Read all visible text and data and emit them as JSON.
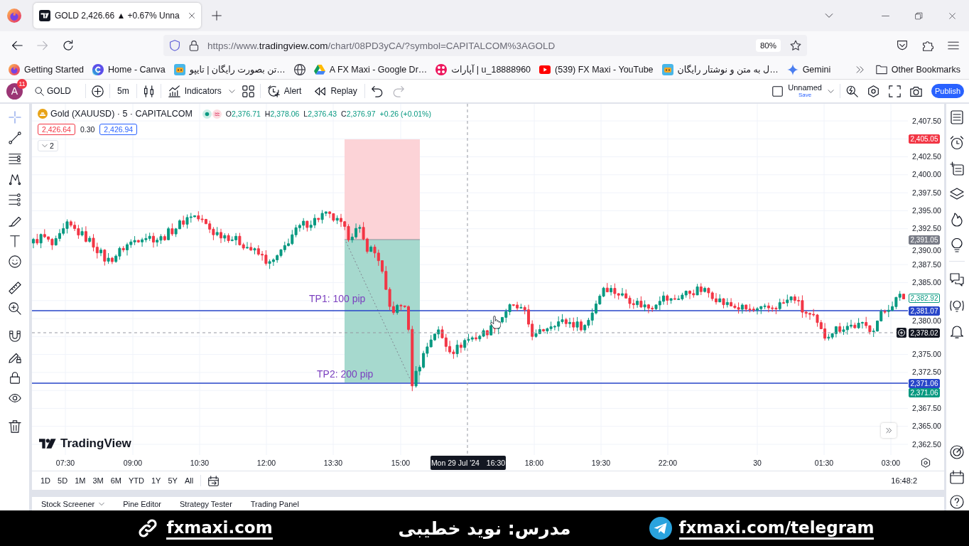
{
  "browser": {
    "tabs": [
      {
        "title": "GOLD 2,426.66 ▲ +0.67% Unna",
        "selected": true
      }
    ],
    "nav_buttons": [
      {
        "kind": "back",
        "disabled": false
      },
      {
        "kind": "forward",
        "disabled": true
      },
      {
        "kind": "reload",
        "disabled": false
      }
    ],
    "url": {
      "scheme": "https://www.",
      "domain": "tradingview.com",
      "path": "/chart/08PD3yCA/?symbol=CAPITALCOM%3AGOLD"
    },
    "zoom": "80%",
    "bookmarks": [
      {
        "kind": "flame-circle",
        "label": "Getting Started"
      },
      {
        "kind": "c-circle",
        "label": "Home - Canva"
      },
      {
        "kind": "tile",
        "label": "تن بصورت رایگان | تایپو…"
      },
      {
        "kind": "globe"
      },
      {
        "kind": "triangle",
        "label": "A FX Maxi - Google Dr…"
      },
      {
        "kind": "flower",
        "label": "آپارات | u_18888960"
      },
      {
        "kind": "play",
        "label": "(539) FX Maxi - YouTube"
      },
      {
        "kind": "tile",
        "label": "ل به متن و نوشتار رایگان…"
      },
      {
        "kind": "sparkle",
        "label": "Gemini"
      }
    ],
    "other_bookmarks": "Other Bookmarks"
  },
  "chart_toolbar": {
    "avatar": {
      "initial": "A",
      "badge": "11"
    },
    "symbol": "GOLD",
    "interval": "5m",
    "indicators": "Indicators",
    "alert": "Alert",
    "replay": "Replay",
    "history": [
      {
        "kind": "undo",
        "disabled": false
      },
      {
        "kind": "redo",
        "disabled": true
      }
    ],
    "layout": {
      "name": "Unnamed",
      "action": "Save"
    },
    "publish": "Publish"
  },
  "legend": {
    "title": "Gold (XAUUSD) · 5 · CAPITALCOM",
    "ohlc": [
      {
        "label": "O",
        "value": "2,376.71"
      },
      {
        "label": "H",
        "value": "2,378.06"
      },
      {
        "label": "L",
        "value": "2,376.43"
      },
      {
        "label": "C",
        "value": "2,376.97"
      }
    ],
    "change": "+0.26 (+0.01%)",
    "sell": "2,426.64",
    "spread": "0.30",
    "buy": "2,426.94",
    "hidden_count": "2"
  },
  "chart": {
    "labels": [
      "TP1: 100 pip",
      "TP2: 200 pip"
    ],
    "logo": "TradingView"
  },
  "price_axis": {
    "labels": [
      "2,407.50",
      "2,402.50",
      "2,400.00",
      "2,397.50",
      "2,395.00",
      "2,392.50",
      "2,390.00",
      "2,387.50",
      "2,385.00",
      "2,380.00",
      "2,375.00",
      "2,372.50",
      "2,367.50",
      "2,365.00",
      "2,362.50"
    ],
    "tags": [
      {
        "text": "2,405.05",
        "color": "#f23645",
        "kind": "filled"
      },
      {
        "text": "2,391.05",
        "color": "#787b86",
        "kind": "filled"
      },
      {
        "text": "2,382.92",
        "color": "#089981",
        "kind": "outline"
      },
      {
        "text": "2,381.07",
        "color": "#2745c9",
        "kind": "filled"
      },
      {
        "text": "2,378.02",
        "color": "#131722",
        "kind": "filled"
      },
      {
        "text": "2,371.06",
        "color": "#2745c9",
        "kind": "filled"
      },
      {
        "text": "2,371.06",
        "color": "#089981",
        "kind": "filled"
      }
    ]
  },
  "time_axis": {
    "labels": [
      "07:30",
      "09:00",
      "10:30",
      "12:00",
      "13:30",
      "15:00",
      "18:00",
      "19:30",
      "22:00",
      "30",
      "01:30",
      "03:00"
    ],
    "crosshair": {
      "date": "Mon 29 Jul '24",
      "time": "16:30"
    }
  },
  "date_ranges": [
    "1D",
    "5D",
    "1M",
    "3M",
    "6M",
    "YTD",
    "1Y",
    "5Y",
    "All"
  ],
  "clock": "16:48:2",
  "bottom_panel": [
    {
      "label": "Stock Screener",
      "menu": true
    },
    {
      "label": "Pine Editor",
      "menu": false
    },
    {
      "label": "Strategy Tester",
      "menu": false
    },
    {
      "label": "Trading Panel",
      "menu": false
    }
  ],
  "banner": {
    "site": "fxmaxi.com",
    "instructor": "مدرس: نوید خطیبی",
    "telegram": "fxmaxi.com/telegram"
  }
}
